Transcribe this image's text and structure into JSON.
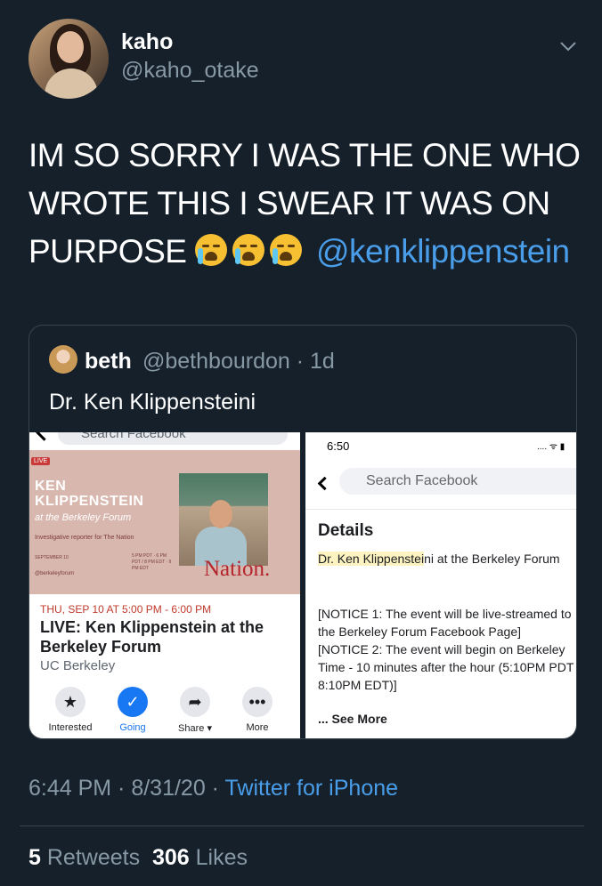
{
  "author": {
    "name": "kaho",
    "handle": "@kaho_otake"
  },
  "tweet": {
    "text": "IM SO SORRY I WAS THE ONE WHO WROTE THIS I SWEAR IT WAS ON PURPOSE",
    "emoji": "😭 😭 😭",
    "mention": "@kenklippenstein"
  },
  "quoted": {
    "name": "beth",
    "handle": "@bethbourdon",
    "age": "· 1d",
    "text": "Dr. Ken Klippensteini",
    "shot1": {
      "search_placeholder": "Search Facebook",
      "live_tag": "LIVE",
      "banner_title": "KEN KLIPPENSTEIN",
      "banner_subtitle": "at the Berkeley Forum",
      "banner_role": "Investigative reporter for The Nation",
      "banner_date": "SEPTEMBER 10",
      "banner_times": "5 PM PDT · 6 PM PDT / 8 PM EDT · 9 PM EDT",
      "banner_social": "@berkeleyforum",
      "banner_brand": "Nation.",
      "event_date": "THU, SEP 10 AT 5:00 PM - 6:00 PM",
      "event_title": "LIVE: Ken Klippenstein at the Berkeley Forum",
      "event_location": "UC Berkeley",
      "actions": [
        "Interested",
        "Going",
        "Share ▾",
        "More"
      ]
    },
    "shot2": {
      "time": "6:50",
      "search_placeholder": "Search Facebook",
      "heading": "Details",
      "highlight": "Dr. Ken Klippenstei",
      "detail_rest": "ni at the Berkeley Forum",
      "notice_lines": [
        "[NOTICE 1: The event will be live-streamed to",
        "the Berkeley Forum Facebook Page]",
        "[NOTICE 2: The event will begin on Berkeley",
        "Time - 10 minutes after the hour (5:10PM PDT",
        "8:10PM EDT)]"
      ],
      "see_more": "... See More"
    }
  },
  "meta": {
    "timestamp": "6:44 PM · 8/31/20 · ",
    "source": "Twitter for iPhone"
  },
  "stats": {
    "retweets": "5",
    "retweets_label": "Retweets",
    "likes": "306",
    "likes_label": "Likes"
  },
  "colors": {
    "background": "#15202b",
    "link": "#4a9de8",
    "muted": "#8899a6"
  }
}
